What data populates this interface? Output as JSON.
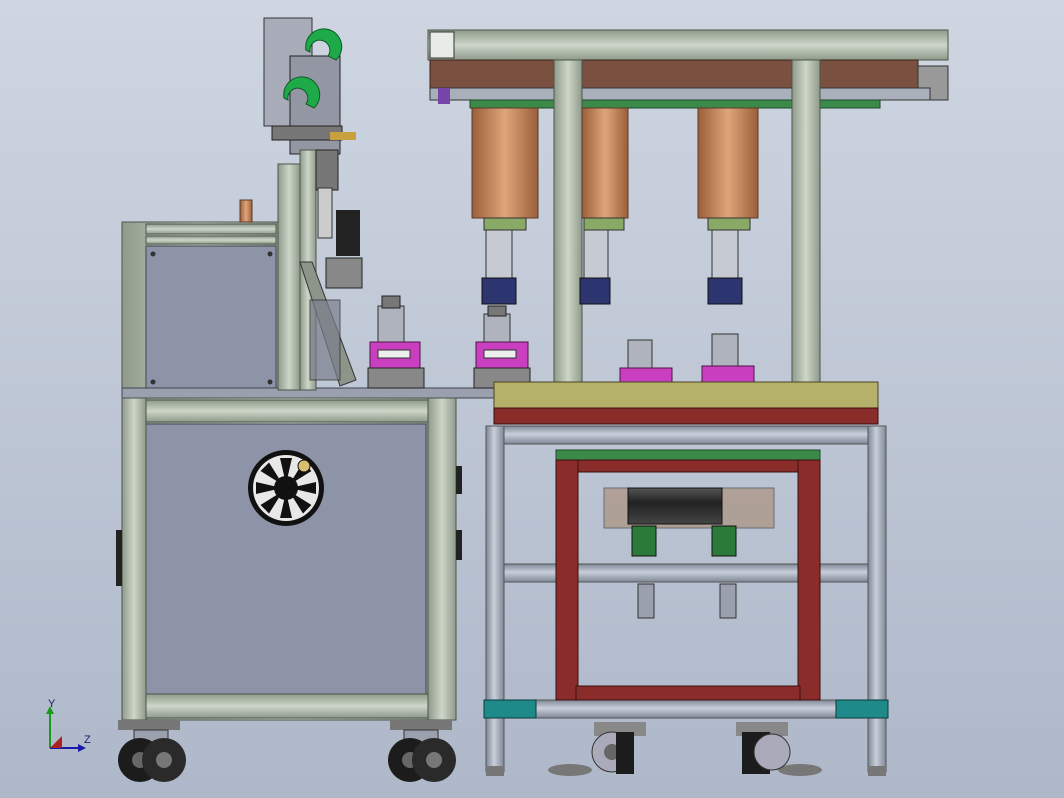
{
  "viewport": {
    "background_top": "#cfd6e2",
    "background_bottom": "#aeb8c9"
  },
  "colors": {
    "extrusion": "#b9c4b4",
    "extrusion_dark": "#6e7a6a",
    "panel": "#8e94a8",
    "panel_dark": "#6c7184",
    "tube": "#a6adbb",
    "frame_red": "#8a2d2a",
    "plate_green": "#3c8a4a",
    "plate_tan": "#b5b06a",
    "copper": "#c48456",
    "magenta": "#c93fbf",
    "navy": "#2d3570",
    "caster_black": "#1c1c1c",
    "teal": "#1e8a8a",
    "reel_green": "#1faa4a",
    "rail_brown": "#7a5040"
  },
  "triad": {
    "y_label": "Y",
    "z_label": "Z"
  },
  "icons": {
    "fan": "fan-icon",
    "triad": "axis-triad-icon"
  }
}
